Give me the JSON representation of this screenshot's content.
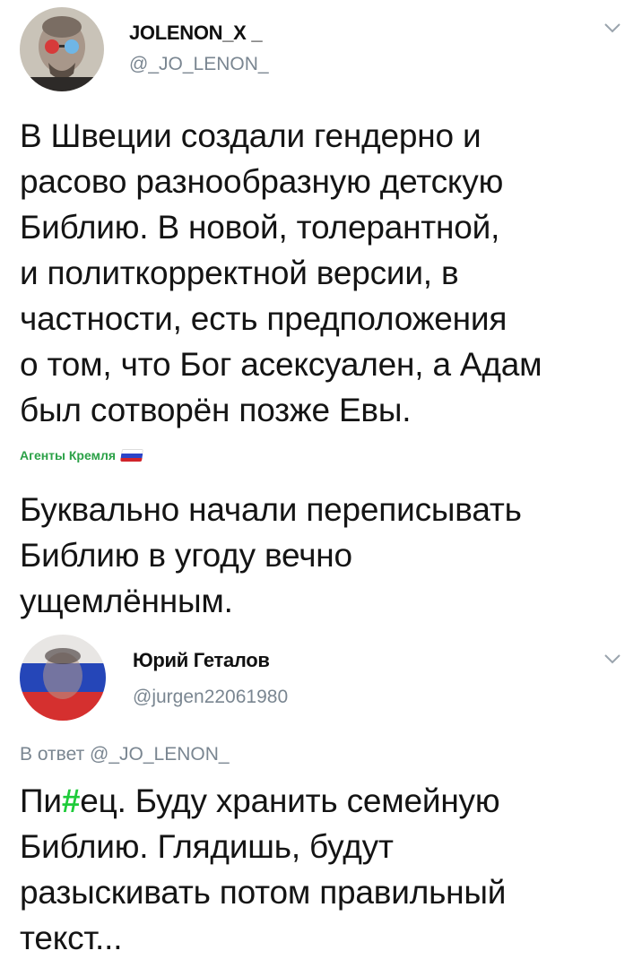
{
  "tweet1": {
    "display_name": "JOLENON_X _",
    "handle": "@_JO_LENON_",
    "text": "В Швеции создали гендерно и\nрасово разнообразную детскую\nБиблию. В новой, толерантной,\nи политкорректной версии, в\nчастности, есть предположения\nо том, что Бог асексуален, а Адам\nбыл сотворён позже Евы.",
    "source_label": "Агенты Кремля",
    "comment": "Буквально начали переписывать\nБиблию в угоду вечно\nущемлённым.",
    "icons": {
      "menu": "chevron-down-icon",
      "flag": "russia-flag-icon"
    }
  },
  "tweet2": {
    "display_name": "Юрий Геталов",
    "handle": "@jurgen22061980",
    "reply_prefix": "В ответ",
    "reply_to": "@_JO_LENON_",
    "text_part1": "Пи",
    "censor_symbol": "#",
    "text_part2": "ец. Буду хранить семейную\nБиблию. Глядишь, будут\nразыскивать потом правильный\nтекст...",
    "icons": {
      "menu": "chevron-down-icon"
    }
  },
  "colors": {
    "handle_gray": "#7a8691",
    "caption_green": "#2ba147",
    "censor_green": "#1ecb3a"
  }
}
